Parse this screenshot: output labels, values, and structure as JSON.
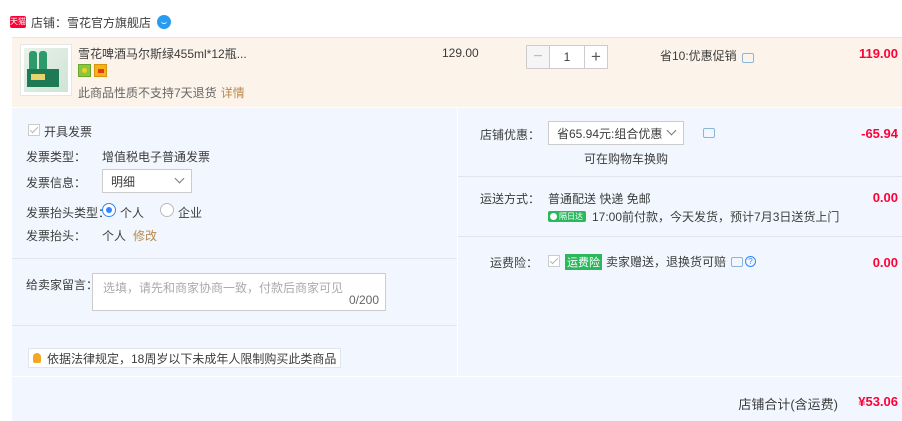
{
  "shop": {
    "badge": "天猫",
    "label": "店铺：雪花官方旗舰店",
    "chat_icon": "wangwang-chat-icon"
  },
  "item": {
    "title": "雪花啤酒马尔斯绿455ml*12瓶...",
    "note": "此商品性质不支持7天退货",
    "note_link": "详情",
    "unit_price": "129.00",
    "quantity": "1",
    "minus": "−",
    "plus": "+",
    "promo": "省10:优惠促销",
    "total": "119.00"
  },
  "invoice": {
    "open_label": "开具发票",
    "type_label": "发票类型：",
    "type_value": "增值税电子普通发票",
    "info_label": "发票信息：",
    "info_value": "明细",
    "title_type_label": "发票抬头类型：",
    "opt_personal": "个人",
    "opt_company": "企业",
    "title_label": "发票抬头：",
    "title_value": "个人",
    "edit": "修改"
  },
  "message": {
    "label": "给卖家留言：",
    "placeholder": "选填，请先和商家协商一致，付款后商家可见",
    "counter": "0/200"
  },
  "notice": "依据法律规定，18周岁以下未成年人限制购买此类商品",
  "shop_coupon": {
    "label": "店铺优惠：",
    "selected": "省65.94元:组合优惠",
    "hint": "可在购物车换购",
    "amount": "-65.94"
  },
  "shipping": {
    "label": "运送方式：",
    "method": "普通配送 快递 免邮",
    "badge": "隔日达",
    "eta": "17:00前付款，今天发货，预计7月3日送货上门",
    "amount": "0.00"
  },
  "insurance": {
    "label": "运费险：",
    "tag": "运费险",
    "desc": "卖家赠送，退换货可赔",
    "amount": "0.00"
  },
  "footer": {
    "label": "店铺合计(含运费)",
    "total": "¥53.06"
  }
}
